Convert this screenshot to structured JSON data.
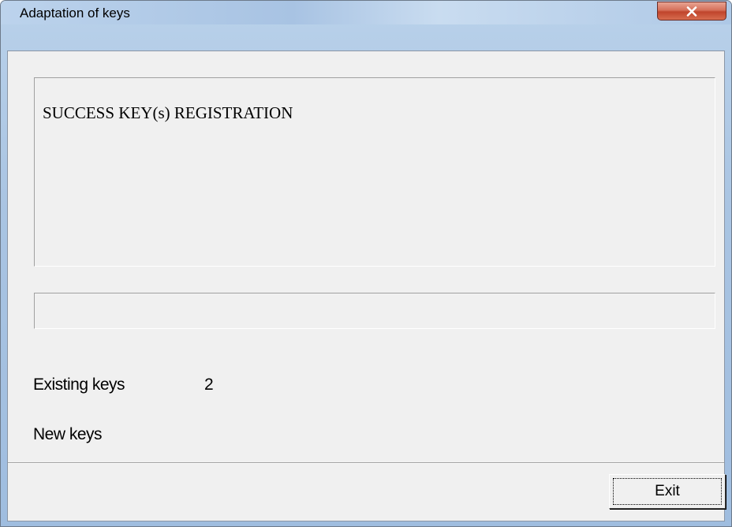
{
  "window": {
    "title": "Adaptation of keys"
  },
  "message": {
    "text": "SUCCESS KEY(s) REGISTRATION"
  },
  "status": {
    "text": ""
  },
  "stats": {
    "existing_label": "Existing keys",
    "existing_value": "2",
    "new_label": "New keys"
  },
  "buttons": {
    "exit_label": "Exit"
  },
  "icons": {
    "close": "close-icon"
  },
  "colors": {
    "dialog_background": "#f0f0f0",
    "close_button": "#c7503a",
    "titlebar": "#b9d1ea"
  }
}
